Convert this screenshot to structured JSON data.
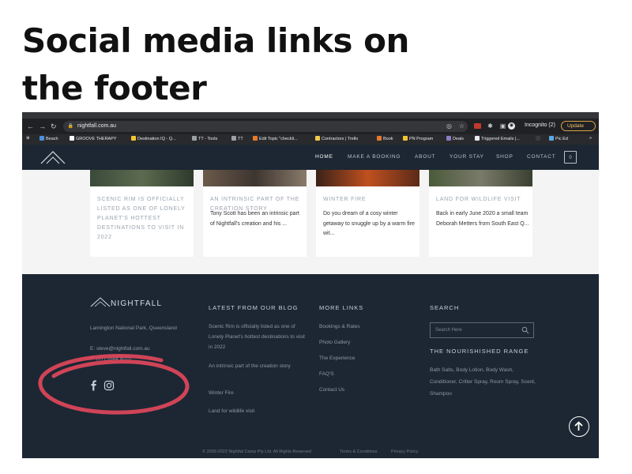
{
  "slide": {
    "title": "Social media links on the footer"
  },
  "browser": {
    "url": "nightfall.com.au",
    "incognito_label": "Incognito (2)",
    "update_label": "Update",
    "bookmarks": [
      {
        "label": "Beach",
        "color": "#4a90d9"
      },
      {
        "label": "GROOVE THERAPY",
        "color": "#ffffff"
      },
      {
        "label": "Destination IQ - Q...",
        "color": "#f4c430"
      },
      {
        "label": "TT - Tools",
        "color": "#9aa0a6"
      },
      {
        "label": "TT",
        "color": "#9aa0a6"
      },
      {
        "label": "Edit Topic \"checkli...",
        "color": "#e8792b"
      },
      {
        "label": "Contractors | Trello",
        "color": "#f2c94c"
      },
      {
        "label": "Book",
        "color": "#e8792b"
      },
      {
        "label": "PN Program",
        "color": "#f4c430"
      },
      {
        "label": "Deals",
        "color": "#8e7cc3"
      },
      {
        "label": "Triggered Emails |...",
        "color": "#e8eaed"
      },
      {
        "label": "Pic Ed",
        "color": "#5aa9e6"
      }
    ]
  },
  "site_nav": {
    "items": [
      {
        "label": "HOME",
        "active": true
      },
      {
        "label": "MAKE A BOOKING",
        "active": false
      },
      {
        "label": "ABOUT",
        "active": false
      },
      {
        "label": "YOUR STAY",
        "active": false
      },
      {
        "label": "SHOP",
        "active": false
      },
      {
        "label": "CONTACT",
        "active": false
      }
    ],
    "cart_count": "0"
  },
  "cards": [
    {
      "title": "SCENIC RIM IS OFFICIALLY LISTED AS ONE OF LONELY PLANET'S HOTTEST DESTINATIONS TO VISIT IN 2022",
      "excerpt": ""
    },
    {
      "title": "AN INTRINSIC PART OF THE CREATION STORY",
      "excerpt": "Tony Scott has been an intrinsic part of Nightfall's creation and his ..."
    },
    {
      "title": "WINTER FIRE",
      "excerpt": "Do you dream of a cosy winter getaway to snuggle up by a warm fire wit..."
    },
    {
      "title": "LAND FOR WILDLIFE VISIT",
      "excerpt": "Back in early June 2020 a small team Deborah Metters from South East Q..."
    }
  ],
  "footer": {
    "brand": "NIGHTFALL",
    "address": "Lamington National Park, Queensland",
    "email": "E: steve@nightfall.com.au",
    "phone": "P: (07) 5544 8070",
    "blog_heading": "LATEST FROM OUR BLOG",
    "blog_links": [
      "Scenic Rim is officially listed as one of Lonely Planet's hottest destinations to visit in 2022",
      "An intrinsic part of the creation story",
      "Winter Fire",
      "Land for wildlife visit"
    ],
    "more_heading": "MORE LINKS",
    "more_links": [
      "Bookings & Rates",
      "Photo Gallery",
      "The Experience",
      "FAQ'S",
      "Contact Us"
    ],
    "search_heading": "SEARCH",
    "search_placeholder": "Search Here",
    "range_heading": "THE NOURISHISHED RANGE",
    "range_text": "Bath Salts, Body Lotion, Body Wash, Conditioner, Critter Spray, Room Spray, Scent, Shampoo",
    "social": [
      {
        "name": "facebook-icon"
      },
      {
        "name": "instagram-icon"
      }
    ],
    "copyright": "© 2009-2022 Nightfal Camp Pty Ltd. All Rights Reserved",
    "terms": "Terms & Conditions",
    "privacy": "Privacy Policy"
  },
  "colors": {
    "dark_navy": "#1c2733",
    "highlight": "#e0475a",
    "update_accent": "#d9a24a"
  }
}
